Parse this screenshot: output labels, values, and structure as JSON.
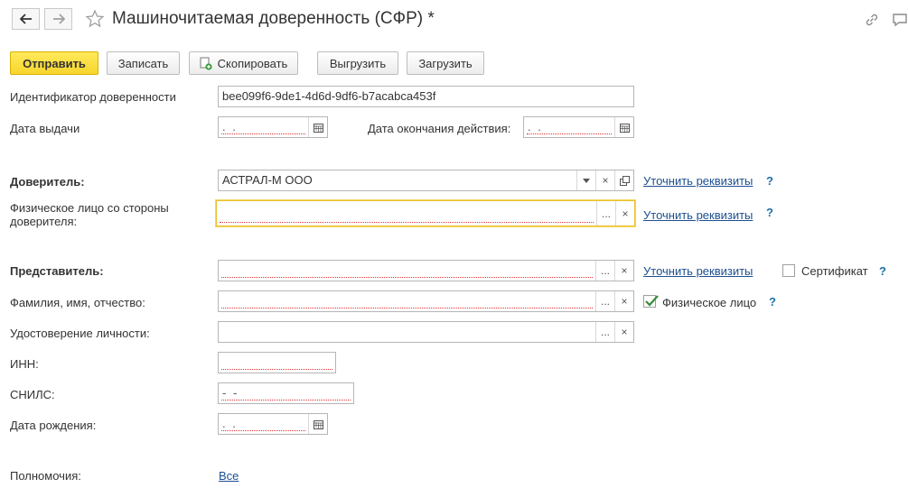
{
  "window": {
    "title": "Машиночитаемая доверенность (СФР) *",
    "icons": [
      "back-arrow-icon",
      "forward-arrow-icon",
      "favorite-star-icon",
      "link-icon",
      "comment-icon"
    ]
  },
  "toolbar": {
    "send": "Отправить",
    "save": "Записать",
    "copy": "Скопировать",
    "export": "Выгрузить",
    "import": "Загрузить"
  },
  "form": {
    "identifier_label": "Идентификатор доверенности",
    "identifier_value": "bee099f6-9de1-4d6d-9df6-b7acabca453f",
    "issue_date_label": "Дата выдачи",
    "issue_date_value": " .  .",
    "expiry_date_label": "Дата окончания действия:",
    "expiry_date_value": " .  .",
    "principal_label": "Доверитель:",
    "principal_value": "АСТРАЛ-М ООО",
    "principal_person_label": "Физическое лицо со стороны доверителя:",
    "principal_person_value": "",
    "representative_label": "Представитель:",
    "representative_value": "",
    "fio_label": "Фамилия, имя, отчество:",
    "fio_value": "",
    "id_doc_label": "Удостоверение личности:",
    "id_doc_value": "",
    "inn_label": "ИНН:",
    "inn_value": "",
    "snils_label": "СНИЛС:",
    "snils_value": "  -   -",
    "birth_date_label": "Дата рождения:",
    "birth_date_value": " .  .",
    "powers_label": "Полномочия:",
    "powers_link": "Все"
  },
  "links": {
    "refine": "Уточнить реквизиты",
    "help": "?"
  },
  "checkboxes": {
    "certificate": {
      "label": "Сертификат",
      "checked": false
    },
    "individual": {
      "label": "Физическое лицо",
      "checked": true
    }
  },
  "colors": {
    "primary_button": "#f7d52d",
    "link": "#1d4f91",
    "required_underline": "#e03030",
    "focus_border": "#e9c02c",
    "checkmark": "#3a8a3a"
  }
}
